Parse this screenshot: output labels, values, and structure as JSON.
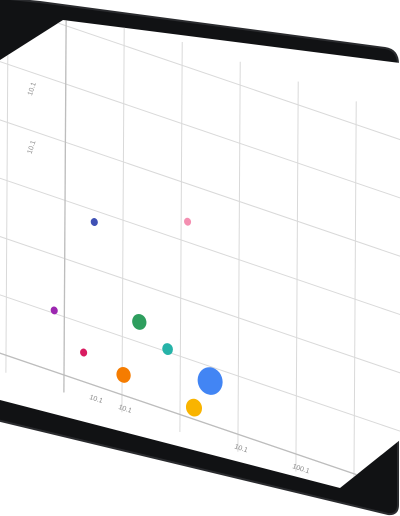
{
  "device": {
    "bezel_color": "#111214",
    "bezel_edge_color": "#2a2b2e",
    "screen_color": "#ffffff",
    "grid_color": "#d9d9d9",
    "axis_color": "#bdbdbd"
  },
  "chart_data": {
    "type": "scatter",
    "title": "",
    "xlabel": "",
    "ylabel": "",
    "grid": true,
    "x_ticks": [
      {
        "label": "10.1",
        "value": 10
      },
      {
        "label": "10.1",
        "value": 20
      },
      {
        "label": "10.1",
        "value": 60
      },
      {
        "label": "100.1",
        "value": 80
      }
    ],
    "y_ticks": [
      {
        "label": "10.1",
        "value": 6
      },
      {
        "label": "10.1",
        "value": 5
      },
      {
        "label": "10.1",
        "value": 4
      }
    ],
    "xlim": [
      0,
      90
    ],
    "ylim": [
      0,
      6
    ],
    "points": [
      {
        "x": 42.2,
        "y": 3.35,
        "size": 4,
        "color": "#f48fb1"
      },
      {
        "x": 10.1,
        "y": 2.8,
        "size": 4,
        "color": "#3f51b5"
      },
      {
        "x": 25.8,
        "y": 1.35,
        "size": 8,
        "color": "#2e9e5e"
      },
      {
        "x": 35.6,
        "y": 1.05,
        "size": 6,
        "color": "#26b3a8"
      },
      {
        "x": -3.5,
        "y": 1.05,
        "size": 4,
        "color": "#9c27b0"
      },
      {
        "x": 6.7,
        "y": 0.5,
        "size": 4,
        "color": "#d81b60"
      },
      {
        "x": 20.5,
        "y": 0.35,
        "size": 8,
        "color": "#f57c00"
      },
      {
        "x": 50.3,
        "y": 0.75,
        "size": 14,
        "color": "#4285f4"
      },
      {
        "x": 44.8,
        "y": 0.2,
        "size": 9,
        "color": "#f9b400"
      }
    ]
  }
}
